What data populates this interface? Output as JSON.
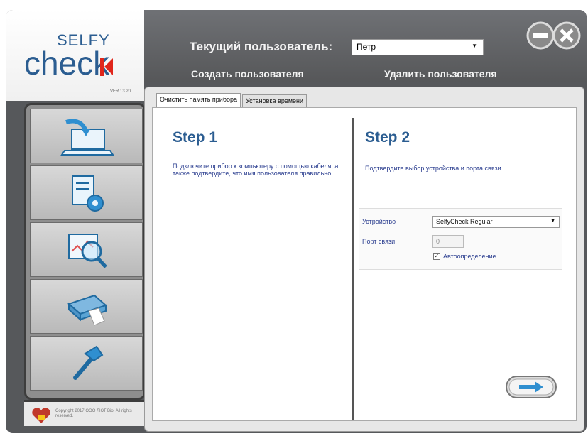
{
  "logo": {
    "top": "SELFY",
    "bottom": "check",
    "version": "VER : 3.20"
  },
  "header": {
    "current_user_label": "Текущий пользователь:",
    "current_user_value": "Петр",
    "create_user": "Создать пользователя",
    "delete_user": "Удалить пользователя"
  },
  "tabs": [
    {
      "label": "Очистить память прибора",
      "active": true
    },
    {
      "label": "Установка времени",
      "active": false
    }
  ],
  "step1": {
    "title": "Step 1",
    "desc": "Подключите прибор к компьютеру с помощью кабеля, а также подтвердите, что имя пользователя правильно"
  },
  "step2": {
    "title": "Step 2",
    "desc": "Подтвердите выбор устройства и порта связи",
    "device_label": "Устройство",
    "device_value": "SelfyCheck Regular",
    "port_label": "Порт связи",
    "port_value": "0",
    "auto_label": "Автоопределение",
    "auto_checked": true
  },
  "footer": {
    "copyright": "Copyright 2017 OOO ЛЮТ Bio. All rights reserved."
  },
  "nav_icons": [
    "laptop-arrow-icon",
    "document-gear-icon",
    "magnify-chart-icon",
    "printer-icon",
    "hammer-icon"
  ],
  "colors": {
    "brand_blue": "#2b5d91",
    "brand_red": "#e0261b",
    "frame_dark": "#56585b"
  }
}
